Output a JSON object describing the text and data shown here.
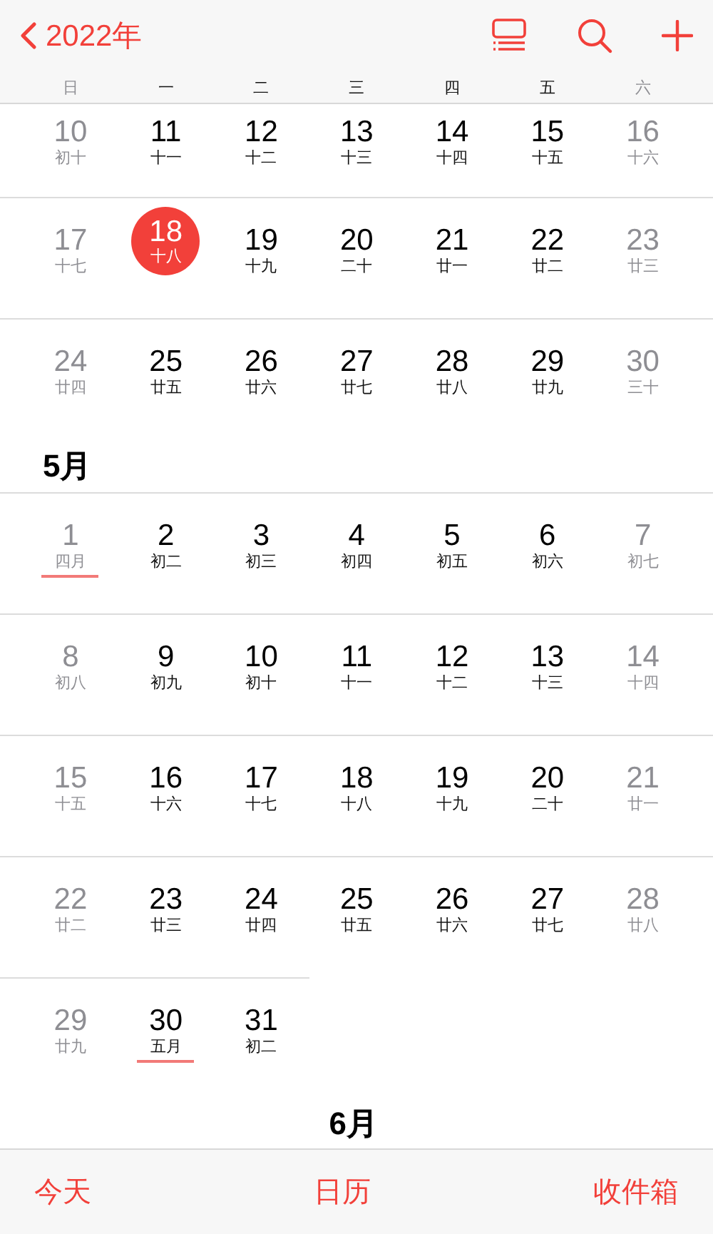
{
  "nav_bar": {
    "back_label": "2022年"
  },
  "weekdays": [
    "日",
    "一",
    "二",
    "三",
    "四",
    "五",
    "六"
  ],
  "months": [
    {
      "weeks": [
        {
          "days": [
            {
              "day": "10",
              "lunar": "初十",
              "today": false,
              "lunar_month_start": false
            },
            {
              "day": "11",
              "lunar": "十一",
              "today": false,
              "lunar_month_start": false
            },
            {
              "day": "12",
              "lunar": "十二",
              "today": false,
              "lunar_month_start": false
            },
            {
              "day": "13",
              "lunar": "十三",
              "today": false,
              "lunar_month_start": false
            },
            {
              "day": "14",
              "lunar": "十四",
              "today": false,
              "lunar_month_start": false
            },
            {
              "day": "15",
              "lunar": "十五",
              "today": false,
              "lunar_month_start": false
            },
            {
              "day": "16",
              "lunar": "十六",
              "today": false,
              "lunar_month_start": false
            }
          ]
        },
        {
          "days": [
            {
              "day": "17",
              "lunar": "十七",
              "today": false,
              "lunar_month_start": false
            },
            {
              "day": "18",
              "lunar": "十八",
              "today": true,
              "lunar_month_start": false
            },
            {
              "day": "19",
              "lunar": "十九",
              "today": false,
              "lunar_month_start": false
            },
            {
              "day": "20",
              "lunar": "二十",
              "today": false,
              "lunar_month_start": false
            },
            {
              "day": "21",
              "lunar": "廿一",
              "today": false,
              "lunar_month_start": false
            },
            {
              "day": "22",
              "lunar": "廿二",
              "today": false,
              "lunar_month_start": false
            },
            {
              "day": "23",
              "lunar": "廿三",
              "today": false,
              "lunar_month_start": false
            }
          ]
        },
        {
          "days": [
            {
              "day": "24",
              "lunar": "廿四",
              "today": false,
              "lunar_month_start": false
            },
            {
              "day": "25",
              "lunar": "廿五",
              "today": false,
              "lunar_month_start": false
            },
            {
              "day": "26",
              "lunar": "廿六",
              "today": false,
              "lunar_month_start": false
            },
            {
              "day": "27",
              "lunar": "廿七",
              "today": false,
              "lunar_month_start": false
            },
            {
              "day": "28",
              "lunar": "廿八",
              "today": false,
              "lunar_month_start": false
            },
            {
              "day": "29",
              "lunar": "廿九",
              "today": false,
              "lunar_month_start": false
            },
            {
              "day": "30",
              "lunar": "三十",
              "today": false,
              "lunar_month_start": false
            }
          ]
        }
      ]
    },
    {
      "title": "5月",
      "weeks": [
        {
          "days": [
            {
              "day": "1",
              "lunar": "四月",
              "today": false,
              "lunar_month_start": true
            },
            {
              "day": "2",
              "lunar": "初二",
              "today": false,
              "lunar_month_start": false
            },
            {
              "day": "3",
              "lunar": "初三",
              "today": false,
              "lunar_month_start": false
            },
            {
              "day": "4",
              "lunar": "初四",
              "today": false,
              "lunar_month_start": false
            },
            {
              "day": "5",
              "lunar": "初五",
              "today": false,
              "lunar_month_start": false
            },
            {
              "day": "6",
              "lunar": "初六",
              "today": false,
              "lunar_month_start": false
            },
            {
              "day": "7",
              "lunar": "初七",
              "today": false,
              "lunar_month_start": false
            }
          ]
        },
        {
          "days": [
            {
              "day": "8",
              "lunar": "初八",
              "today": false,
              "lunar_month_start": false
            },
            {
              "day": "9",
              "lunar": "初九",
              "today": false,
              "lunar_month_start": false
            },
            {
              "day": "10",
              "lunar": "初十",
              "today": false,
              "lunar_month_start": false
            },
            {
              "day": "11",
              "lunar": "十一",
              "today": false,
              "lunar_month_start": false
            },
            {
              "day": "12",
              "lunar": "十二",
              "today": false,
              "lunar_month_start": false
            },
            {
              "day": "13",
              "lunar": "十三",
              "today": false,
              "lunar_month_start": false
            },
            {
              "day": "14",
              "lunar": "十四",
              "today": false,
              "lunar_month_start": false
            }
          ]
        },
        {
          "days": [
            {
              "day": "15",
              "lunar": "十五",
              "today": false,
              "lunar_month_start": false
            },
            {
              "day": "16",
              "lunar": "十六",
              "today": false,
              "lunar_month_start": false
            },
            {
              "day": "17",
              "lunar": "十七",
              "today": false,
              "lunar_month_start": false
            },
            {
              "day": "18",
              "lunar": "十八",
              "today": false,
              "lunar_month_start": false
            },
            {
              "day": "19",
              "lunar": "十九",
              "today": false,
              "lunar_month_start": false
            },
            {
              "day": "20",
              "lunar": "二十",
              "today": false,
              "lunar_month_start": false
            },
            {
              "day": "21",
              "lunar": "廿一",
              "today": false,
              "lunar_month_start": false
            }
          ]
        },
        {
          "days": [
            {
              "day": "22",
              "lunar": "廿二",
              "today": false,
              "lunar_month_start": false
            },
            {
              "day": "23",
              "lunar": "廿三",
              "today": false,
              "lunar_month_start": false
            },
            {
              "day": "24",
              "lunar": "廿四",
              "today": false,
              "lunar_month_start": false
            },
            {
              "day": "25",
              "lunar": "廿五",
              "today": false,
              "lunar_month_start": false
            },
            {
              "day": "26",
              "lunar": "廿六",
              "today": false,
              "lunar_month_start": false
            },
            {
              "day": "27",
              "lunar": "廿七",
              "today": false,
              "lunar_month_start": false
            },
            {
              "day": "28",
              "lunar": "廿八",
              "today": false,
              "lunar_month_start": false
            }
          ]
        },
        {
          "days": [
            {
              "day": "29",
              "lunar": "廿九",
              "today": false,
              "lunar_month_start": false
            },
            {
              "day": "30",
              "lunar": "五月",
              "today": false,
              "lunar_month_start": true
            },
            {
              "day": "31",
              "lunar": "初二",
              "today": false,
              "lunar_month_start": false
            }
          ]
        }
      ]
    },
    {
      "title": "6月"
    }
  ],
  "tab_bar": [
    "今天",
    "日历",
    "收件箱"
  ]
}
